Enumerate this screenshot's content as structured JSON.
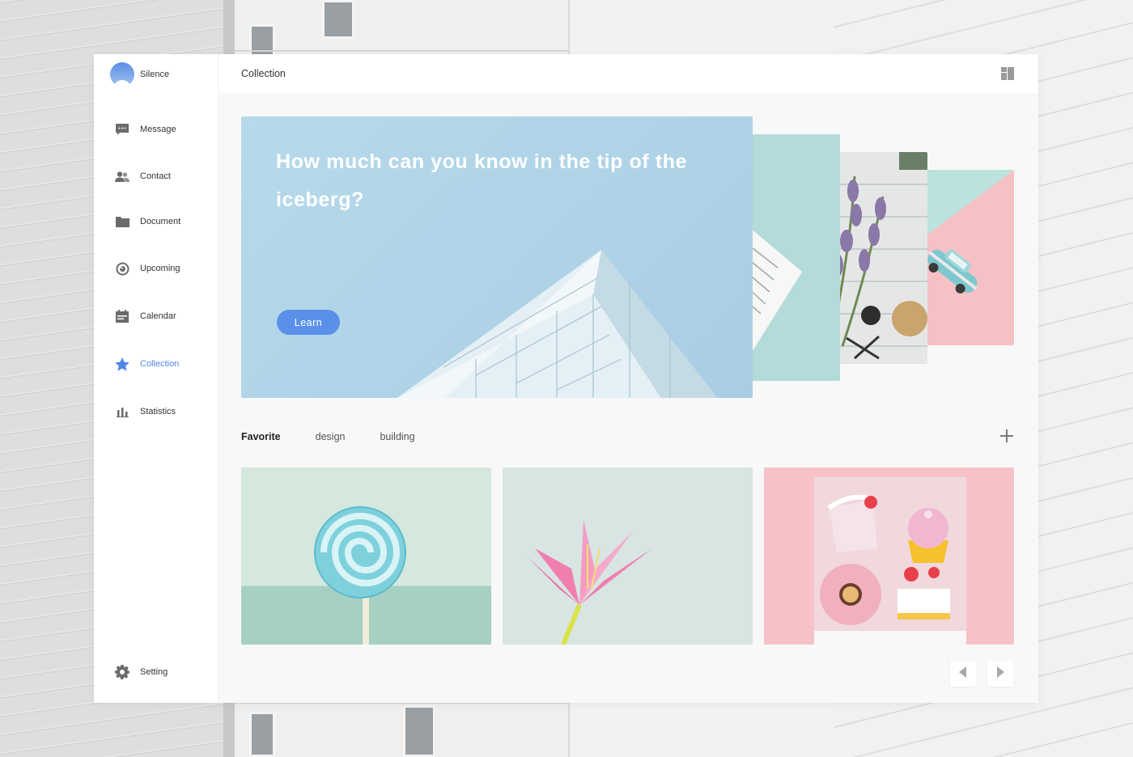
{
  "profile": {
    "name": "Silence"
  },
  "sidebar": {
    "items": [
      {
        "label": "Message",
        "icon": "message-icon"
      },
      {
        "label": "Contact",
        "icon": "contact-icon"
      },
      {
        "label": "Document",
        "icon": "folder-icon"
      },
      {
        "label": "Upcoming",
        "icon": "clock-icon"
      },
      {
        "label": "Calendar",
        "icon": "calendar-icon"
      },
      {
        "label": "Collection",
        "icon": "star-icon",
        "active": true
      },
      {
        "label": "Statistics",
        "icon": "bar-chart-icon"
      }
    ],
    "setting": {
      "label": "Setting",
      "icon": "gear-icon"
    }
  },
  "header": {
    "title": "Collection",
    "action_icon": "layout-icon"
  },
  "hero": {
    "title": "How much can you know in the tip of the iceberg?",
    "button_label": "Learn"
  },
  "tabs": [
    {
      "label": "Favorite",
      "active": true
    },
    {
      "label": "design"
    },
    {
      "label": "building"
    }
  ],
  "gallery": [
    {
      "subject": "lollipop"
    },
    {
      "subject": "paper-lily"
    },
    {
      "subject": "sweets"
    }
  ],
  "colors": {
    "accent": "#4f87e8",
    "button": "#5a90ea",
    "hero_bg": "#b6daea",
    "mint": "#a6d0c1",
    "pink": "#f6c2c8"
  }
}
